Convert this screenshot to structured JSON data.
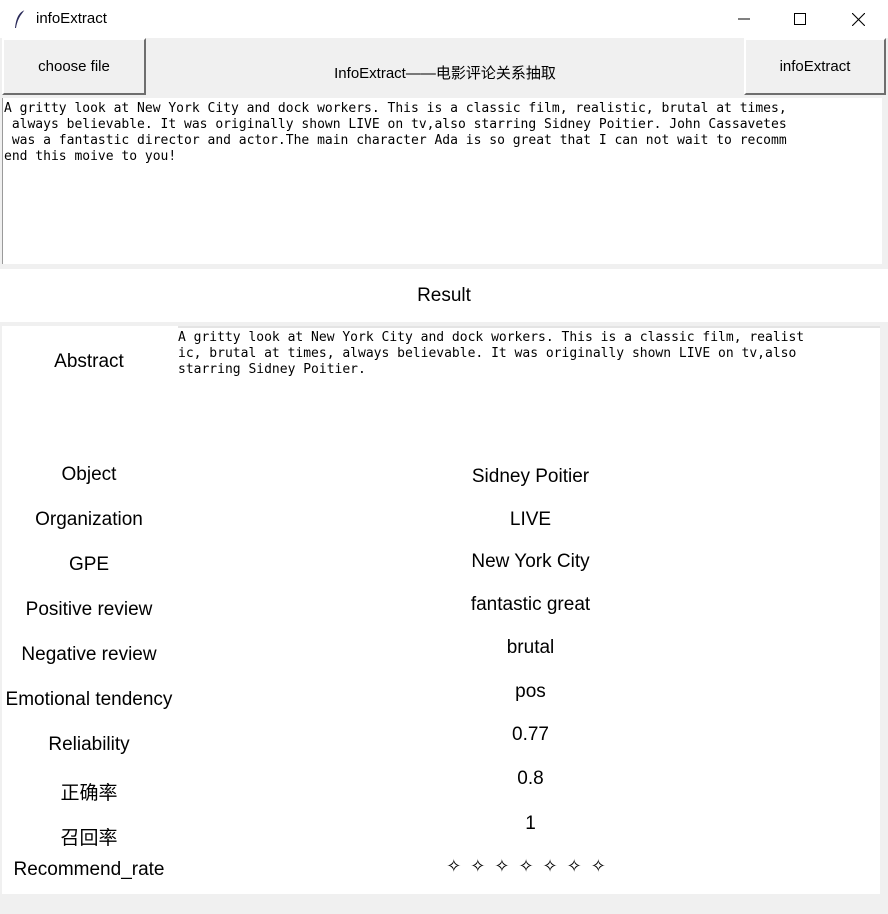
{
  "window": {
    "title": "infoExtract",
    "icons": [
      "feather-icon",
      "minimize-icon",
      "maximize-icon",
      "close-icon"
    ]
  },
  "toolbar": {
    "choose_file_label": "choose file",
    "heading": "InfoExtract——电影评论关系抽取",
    "extract_label": "infoExtract"
  },
  "input": {
    "text": "A gritty look at New York City and dock workers. This is a classic film, realistic, brutal at times,\n always believable. It was originally shown LIVE on tv,also starring Sidney Poitier. John Cassavetes\n was a fantastic director and actor.The main character Ada is so great that I can not wait to recomm\nend this moive to you!"
  },
  "result": {
    "header": "Result",
    "abstract_label": "Abstract",
    "abstract_text": "A gritty look at New York City and dock workers. This is a classic film, realist\nic, brutal at times, always believable. It was originally shown LIVE on tv,also\nstarring Sidney Poitier.",
    "rows": [
      {
        "label": "Object",
        "value": "Sidney Poitier"
      },
      {
        "label": "Organization",
        "value": "LIVE"
      },
      {
        "label": "GPE",
        "value": "New York City"
      },
      {
        "label": "Positive review",
        "value": "fantastic great"
      },
      {
        "label": "Negative review",
        "value": "brutal"
      },
      {
        "label": "Emotional tendency",
        "value": "pos"
      },
      {
        "label": "Reliability",
        "value": "0.77"
      },
      {
        "label": "正确率",
        "value": "0.8"
      },
      {
        "label": "召回率",
        "value": "1"
      },
      {
        "label": "Recommend_rate",
        "value": "✧✧✧✧✧✧✧"
      }
    ]
  }
}
